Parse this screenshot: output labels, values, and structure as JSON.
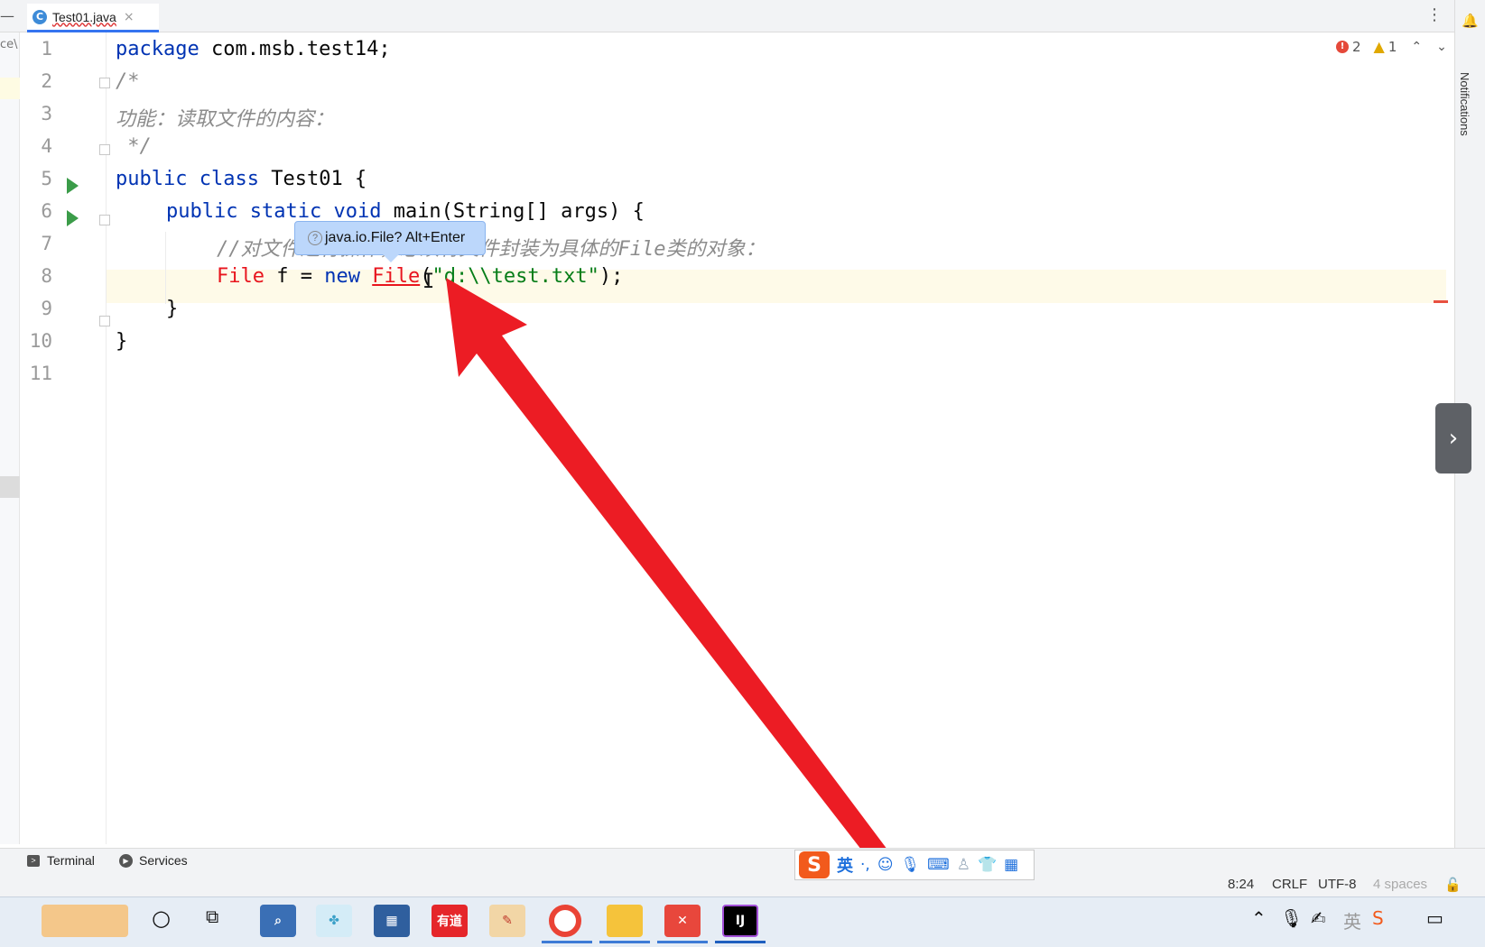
{
  "editor_tab": {
    "label": "Test01.java",
    "close_glyph": "×",
    "icon": "java-class-icon"
  },
  "left_strip": {
    "path_fragment": "ce\\"
  },
  "line_numbers": [
    "1",
    "2",
    "3",
    "4",
    "5",
    "6",
    "7",
    "8",
    "9",
    "10",
    "11"
  ],
  "code": {
    "l1_kw": "package",
    "l1_rest": " com.msb.test14;",
    "l2": "/*",
    "l3": "功能：读取文件的内容：",
    "l4": " */",
    "l5_kw1": "public",
    "l5_kw2": "class",
    "l5_rest": " Test01 {",
    "l6_kw1": "public",
    "l6_kw2": "static",
    "l6_kw3": "void",
    "l6_rest": " main(String[] args) {",
    "l7": "//对文件进行操作，必须将文件封装为具体的File类的对象：",
    "l8_type": "File",
    "l8_var": " f = ",
    "l8_new": "new",
    "l8_cls": "File",
    "l8_open": "(",
    "l8_str": "\"d:\\\\test.txt\"",
    "l8_close": ");",
    "l9": "}",
    "l10": "}"
  },
  "inspection": {
    "errors": "2",
    "warnings": "1"
  },
  "tooltip": {
    "text": "java.io.File? Alt+Enter",
    "icon": "question-icon"
  },
  "right_panel": {
    "notifications_label": "Notifications"
  },
  "bottom_tools": {
    "terminal": "Terminal",
    "services": "Services"
  },
  "status_bar": {
    "position": "8:24",
    "line_sep": "CRLF",
    "encoding": "UTF-8",
    "indent": "4 spaces"
  },
  "ime": {
    "logo": "S",
    "lang": "英",
    "punct": "·,",
    "icons": [
      "smile-icon",
      "mic-icon",
      "keyboard-icon",
      "person-icon",
      "shirt-icon",
      "grid-icon"
    ]
  },
  "taskbar": {
    "apps": [
      {
        "name": "wallpaper-app",
        "label": ""
      },
      {
        "name": "search-circle",
        "label": ""
      },
      {
        "name": "task-view",
        "label": ""
      },
      {
        "name": "magnifier-app",
        "label": ""
      },
      {
        "name": "fiddler-app",
        "label": ""
      },
      {
        "name": "calculator-app",
        "label": ""
      },
      {
        "name": "youdao-app",
        "label": "有道"
      },
      {
        "name": "paint-app",
        "label": ""
      },
      {
        "name": "chrome-app",
        "label": ""
      },
      {
        "name": "file-explorer-app",
        "label": ""
      },
      {
        "name": "xmind-app",
        "label": ""
      },
      {
        "name": "intellij-app",
        "label": "IJ"
      }
    ],
    "ime_indicator": "英"
  },
  "colors": {
    "keyword": "#0033b3",
    "comment": "#8c8c8c",
    "error": "#e8151d",
    "string": "#067d17",
    "arrow": "#ec1c24",
    "tooltip_bg": "#bcd7fb"
  }
}
